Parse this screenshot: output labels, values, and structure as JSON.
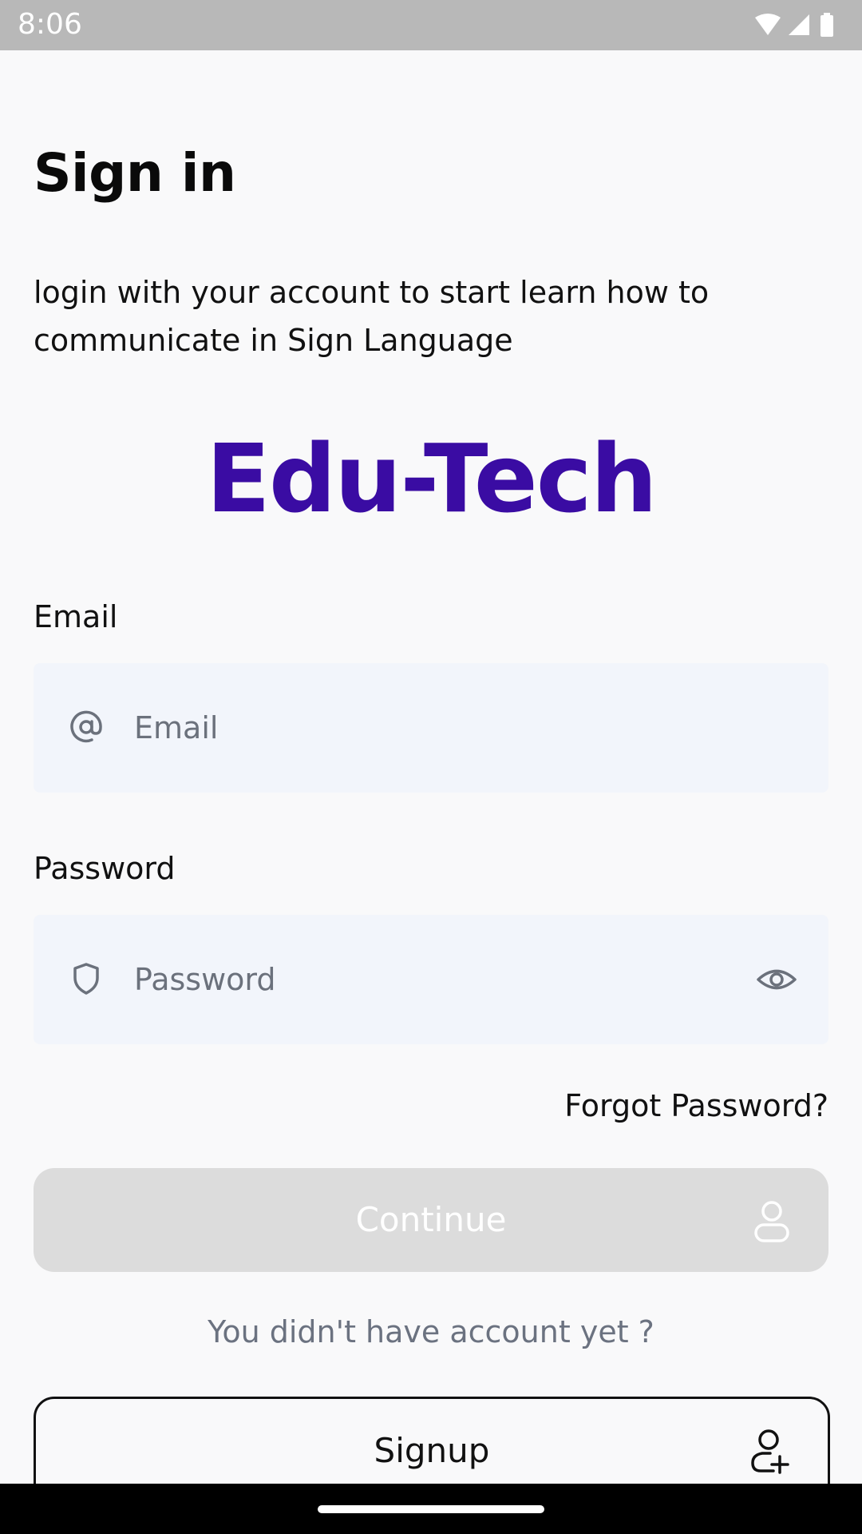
{
  "status_bar": {
    "time": "8:06",
    "icons": [
      "wifi-icon",
      "signal-icon",
      "battery-icon"
    ]
  },
  "header": {
    "title": "Sign in",
    "subtitle": "login with your account to start learn how to communicate in Sign Language"
  },
  "brand": {
    "name": "Edu-Tech",
    "color": "#3a0ca3"
  },
  "form": {
    "email": {
      "label": "Email",
      "placeholder": "Email",
      "value": "",
      "icon": "at-sign-icon"
    },
    "password": {
      "label": "Password",
      "placeholder": "Password",
      "value": "",
      "icon": "shield-icon",
      "toggle_icon": "eye-icon"
    },
    "forgot_label": "Forgot Password?",
    "continue_label": "Continue",
    "continue_icon": "user-icon",
    "no_account_text": "You didn't have account yet ?",
    "signup_label": "Signup",
    "signup_icon": "user-add-icon"
  },
  "colors": {
    "background": "#f9f9fa",
    "input_background": "#f2f5fb",
    "continue_disabled": "#dcdcdc"
  }
}
